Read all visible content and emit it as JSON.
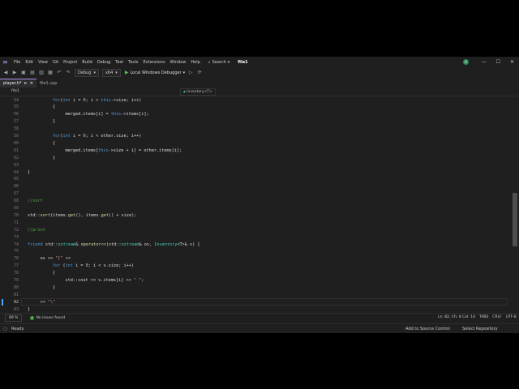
{
  "menubar": {
    "logo": "∞",
    "items": [
      "File",
      "Edit",
      "View",
      "Git",
      "Project",
      "Build",
      "Debug",
      "Test",
      "Tools",
      "Extensions",
      "Window",
      "Help"
    ],
    "search_label": "Search",
    "solution_name": "file1",
    "account_initial": "A"
  },
  "toolbar": {
    "config": "Debug",
    "platform": "x64",
    "run_label": "Local Windows Debugger"
  },
  "tabs": [
    {
      "label": "player.h*",
      "active": true
    },
    {
      "label": "file1.cpp",
      "active": false
    }
  ],
  "navbar": {
    "project": "file1",
    "scope": "Inventory<T>"
  },
  "editor": {
    "line_numbers": [
      54,
      55,
      56,
      57,
      58,
      59,
      60,
      61,
      62,
      63,
      64,
      65,
      66,
      67,
      68,
      69,
      70,
      71,
      72,
      73,
      74,
      75,
      76,
      77,
      78,
      79,
      80,
      81,
      82,
      83
    ],
    "current_line": 82,
    "lines": [
      {
        "n": 54,
        "indent": 3,
        "tokens": [
          [
            "kw",
            "for"
          ],
          [
            "",
            "("
          ],
          [
            "kw",
            "int"
          ],
          [
            "",
            " i = "
          ],
          [
            "nm",
            "0"
          ],
          [
            "",
            "; i < "
          ],
          [
            "kw",
            "this"
          ],
          [
            "",
            "->size; i++)"
          ]
        ]
      },
      {
        "n": 55,
        "indent": 3,
        "tokens": [
          [
            "",
            "{"
          ]
        ]
      },
      {
        "n": 56,
        "indent": 4,
        "tokens": [
          [
            "",
            "merged.items[i] = "
          ],
          [
            "kw",
            "this"
          ],
          [
            "",
            "->items[i];"
          ]
        ]
      },
      {
        "n": 57,
        "indent": 3,
        "tokens": [
          [
            "",
            "}"
          ]
        ]
      },
      {
        "n": 58,
        "indent": 0,
        "tokens": []
      },
      {
        "n": 59,
        "indent": 3,
        "tokens": [
          [
            "kw",
            "for"
          ],
          [
            "",
            "("
          ],
          [
            "kw",
            "int"
          ],
          [
            "",
            " i = "
          ],
          [
            "nm",
            "0"
          ],
          [
            "",
            "; i < other.size; i++)"
          ]
        ]
      },
      {
        "n": 60,
        "indent": 3,
        "tokens": [
          [
            "",
            "{"
          ]
        ]
      },
      {
        "n": 61,
        "indent": 4,
        "tokens": [
          [
            "",
            "merged.items["
          ],
          [
            "kw",
            "this"
          ],
          [
            "",
            "->size + i] = other.items[i];"
          ]
        ]
      },
      {
        "n": 62,
        "indent": 3,
        "tokens": [
          [
            "",
            "}"
          ]
        ]
      },
      {
        "n": 63,
        "indent": 0,
        "tokens": []
      },
      {
        "n": 64,
        "indent": 1,
        "tokens": [
          [
            "",
            "}"
          ]
        ]
      },
      {
        "n": 65,
        "indent": 0,
        "tokens": []
      },
      {
        "n": 66,
        "indent": 0,
        "tokens": []
      },
      {
        "n": 67,
        "indent": 0,
        "tokens": []
      },
      {
        "n": 68,
        "indent": 1,
        "tokens": [
          [
            "cm",
            "//sort"
          ]
        ]
      },
      {
        "n": 69,
        "indent": 0,
        "tokens": []
      },
      {
        "n": 70,
        "indent": 1,
        "tokens": [
          [
            "",
            "std::"
          ],
          [
            "fn",
            "sort"
          ],
          [
            "",
            "(items."
          ],
          [
            "fn",
            "get"
          ],
          [
            "",
            "(), items."
          ],
          [
            "fn",
            "get"
          ],
          [
            "",
            "() + size);"
          ]
        ]
      },
      {
        "n": 71,
        "indent": 0,
        "tokens": []
      },
      {
        "n": 72,
        "indent": 1,
        "tokens": [
          [
            "cm",
            "//print"
          ]
        ]
      },
      {
        "n": 73,
        "indent": 0,
        "tokens": []
      },
      {
        "n": 74,
        "indent": 1,
        "tokens": [
          [
            "kw",
            "friend"
          ],
          [
            "",
            " std::"
          ],
          [
            "ty",
            "ostream"
          ],
          [
            "",
            "& "
          ],
          [
            "fn",
            "operator<<"
          ],
          [
            "",
            "(std::"
          ],
          [
            "ty",
            "ostream"
          ],
          [
            "",
            "& os, "
          ],
          [
            "ty",
            "Inventory"
          ],
          [
            "",
            "<T>& v) {"
          ]
        ]
      },
      {
        "n": 75,
        "indent": 0,
        "tokens": []
      },
      {
        "n": 76,
        "indent": 2,
        "tokens": [
          [
            "",
            "os << "
          ],
          [
            "st",
            "\"[\""
          ],
          [
            "",
            " <<"
          ]
        ]
      },
      {
        "n": 77,
        "indent": 3,
        "tokens": [
          [
            "kw",
            "for"
          ],
          [
            "",
            " ("
          ],
          [
            "kw",
            "int"
          ],
          [
            "",
            " i = "
          ],
          [
            "nm",
            "0"
          ],
          [
            "",
            "; i < v.size; i++)"
          ]
        ]
      },
      {
        "n": 78,
        "indent": 3,
        "tokens": [
          [
            "",
            "{"
          ]
        ]
      },
      {
        "n": 79,
        "indent": 4,
        "tokens": [
          [
            "",
            "std::cout << v.items[i] << "
          ],
          [
            "st",
            "\" \""
          ],
          [
            "",
            ";"
          ]
        ]
      },
      {
        "n": 80,
        "indent": 3,
        "tokens": [
          [
            "",
            "}"
          ]
        ]
      },
      {
        "n": 81,
        "indent": 0,
        "tokens": []
      },
      {
        "n": 82,
        "indent": 2,
        "tokens": [
          [
            "",
            "<< "
          ],
          [
            "st",
            "\"\\\""
          ]
        ]
      },
      {
        "n": 83,
        "indent": 1,
        "tokens": [
          [
            "",
            "}"
          ]
        ]
      }
    ]
  },
  "status": {
    "zoom": "89 %",
    "issues": "No issues found",
    "position": "Ln: 82, Ch: 8  Col: 14",
    "tabs": "TABS",
    "eol": "CRLF",
    "encoding": "UTF-8"
  },
  "bottombar": {
    "ready": "Ready",
    "source_control": "Add to Source Control",
    "repository": "Select Repository"
  },
  "colors": {
    "accent": "#b48ef0",
    "keyword": "#569cd6",
    "comment": "#57a64a",
    "string": "#d69d85",
    "type": "#4ec9b0",
    "function": "#dcdcaa"
  }
}
